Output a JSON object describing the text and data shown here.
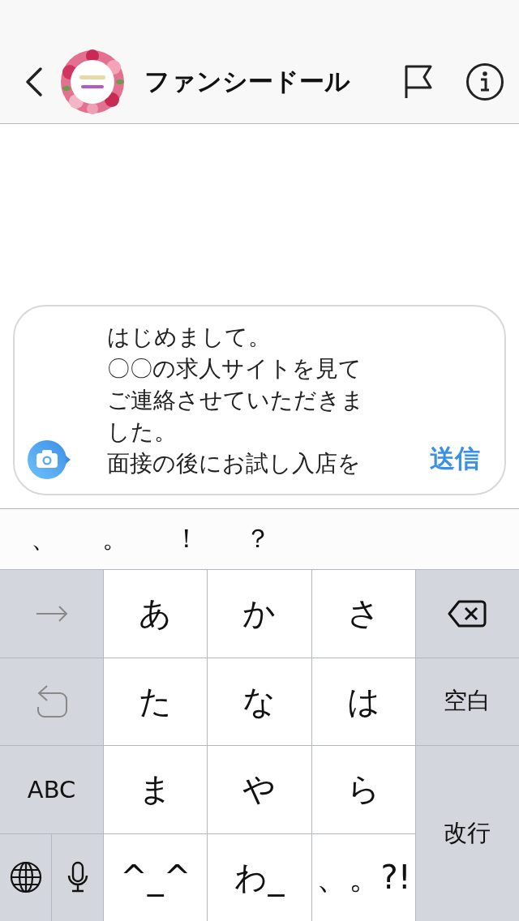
{
  "header": {
    "title": "ファンシードール"
  },
  "composer": {
    "message_lines": [
      "はじめまして。",
      "〇〇の求人サイトを見て",
      "ご連絡させていただきま",
      "した。",
      "面接の後にお試し入店を"
    ],
    "send": "送信"
  },
  "suggestions": [
    "、",
    "。",
    "！",
    "？"
  ],
  "keyboard": [
    {
      "kind": "next"
    },
    {
      "kind": "kana",
      "label": "あ"
    },
    {
      "kind": "kana",
      "label": "か"
    },
    {
      "kind": "kana",
      "label": "さ"
    },
    {
      "kind": "delete"
    },
    {
      "kind": "undo"
    },
    {
      "kind": "kana",
      "label": "た"
    },
    {
      "kind": "kana",
      "label": "な"
    },
    {
      "kind": "kana",
      "label": "は"
    },
    {
      "kind": "function",
      "label": "空白"
    },
    {
      "kind": "function",
      "label": "ABC"
    },
    {
      "kind": "kana",
      "label": "ま"
    },
    {
      "kind": "kana",
      "label": "や"
    },
    {
      "kind": "kana",
      "label": "ら"
    },
    {
      "kind": "enter",
      "label": "改行"
    },
    {
      "kind": "globe-mic"
    },
    {
      "kind": "kana",
      "label": "^_^"
    },
    {
      "kind": "kana",
      "label": "わ_"
    },
    {
      "kind": "kana",
      "label": "、。?!"
    }
  ]
}
